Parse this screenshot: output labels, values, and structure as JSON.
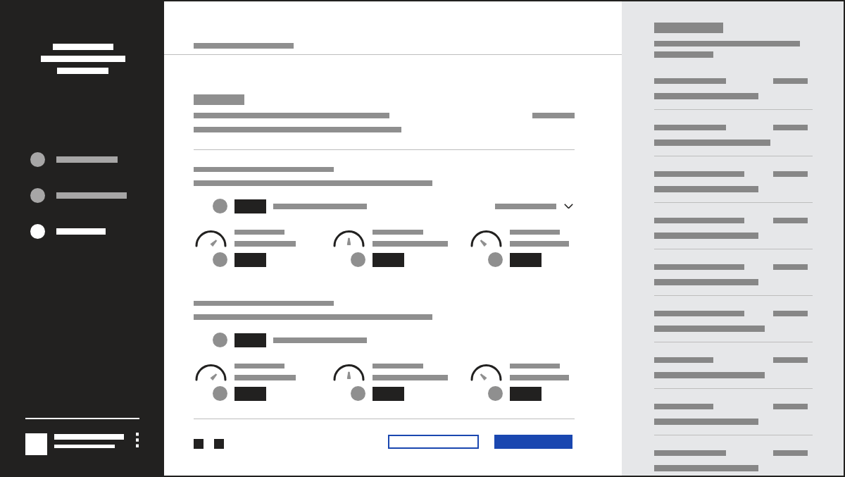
{
  "sidebar": {
    "nav_items": [
      {
        "selected": false
      },
      {
        "selected": false
      },
      {
        "selected": true
      }
    ]
  },
  "option_groups": [
    {
      "kind": "dropdown"
    },
    {
      "kind": "plain"
    }
  ],
  "footer": {
    "buttons": [
      {
        "kind": "secondary"
      },
      {
        "kind": "primary"
      }
    ]
  }
}
